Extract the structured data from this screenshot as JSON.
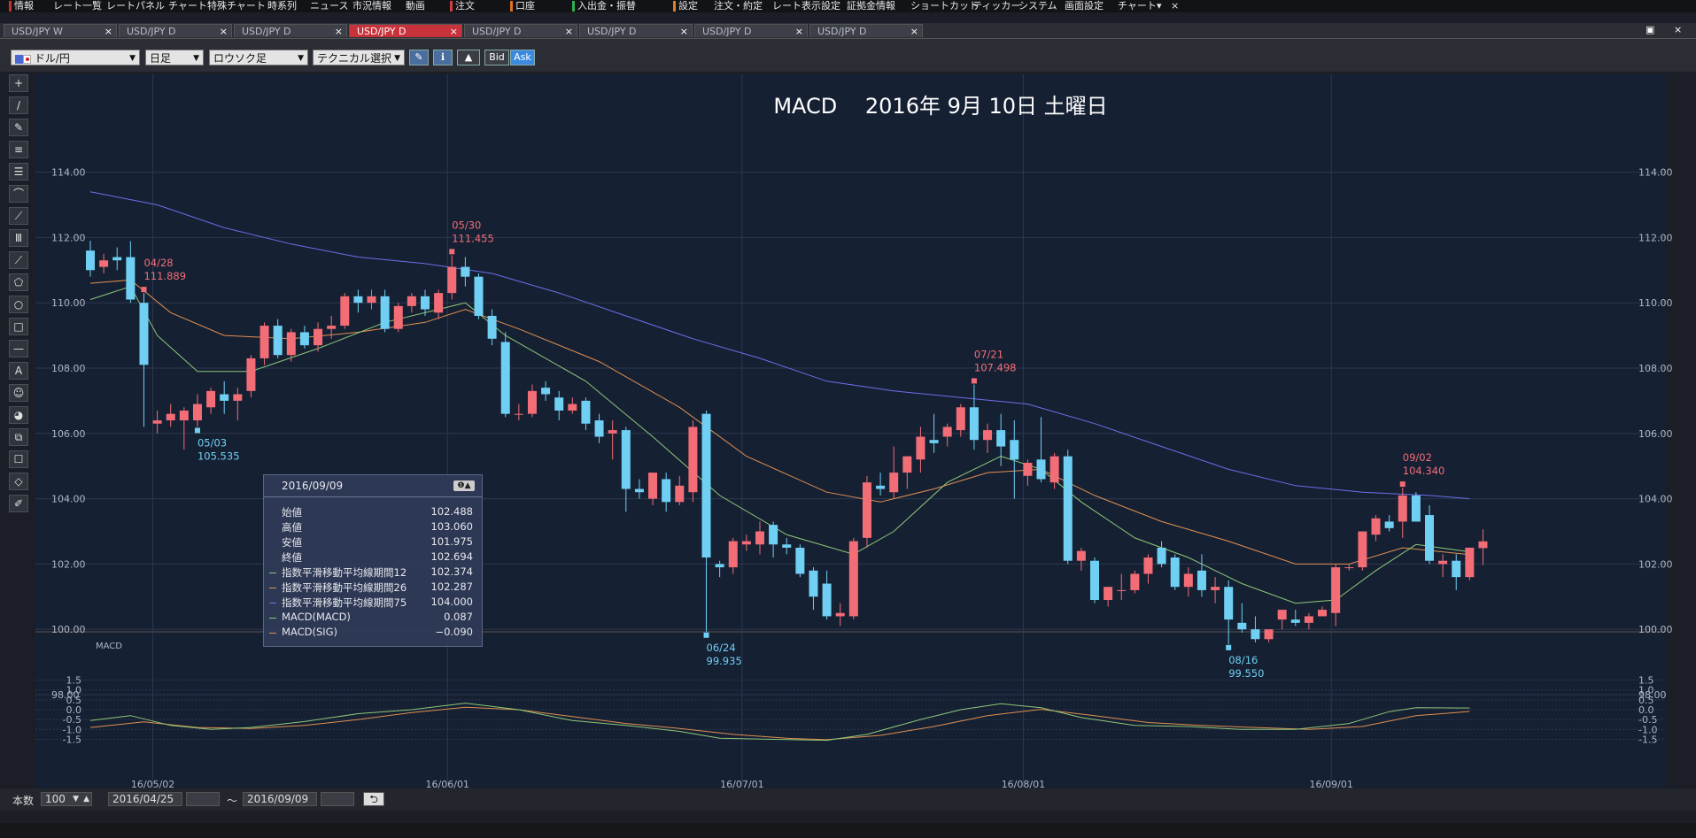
{
  "menu": {
    "items": [
      {
        "label": "情報",
        "x": 16,
        "mark": "#c83030"
      },
      {
        "label": "レート一覧",
        "x": 60
      },
      {
        "label": "レートパネル",
        "x": 120
      },
      {
        "label": "チャート",
        "x": 190
      },
      {
        "label": "特殊チャート",
        "x": 234
      },
      {
        "label": "時系列",
        "x": 302
      },
      {
        "label": "ニュース",
        "x": 350
      },
      {
        "label": "市況情報",
        "x": 398
      },
      {
        "label": "動画",
        "x": 458
      },
      {
        "label": "注文",
        "x": 514,
        "mark": "#d04040"
      },
      {
        "label": "口座",
        "x": 582,
        "mark": "#e07020"
      },
      {
        "label": "入出金・振替",
        "x": 652,
        "mark": "#30b050"
      },
      {
        "label": "設定",
        "x": 766,
        "mark": "#e08020"
      },
      {
        "label": "注文・約定",
        "x": 806
      },
      {
        "label": "レート表示設定",
        "x": 872
      },
      {
        "label": "証拠金情報",
        "x": 956
      },
      {
        "label": "ショートカット",
        "x": 1028
      },
      {
        "label": "ティッカー",
        "x": 1098
      },
      {
        "label": "システム",
        "x": 1150
      },
      {
        "label": "画面設定",
        "x": 1202
      },
      {
        "label": "チャート",
        "x": 1262
      },
      {
        "label": "▾",
        "x": 1306
      },
      {
        "label": "×",
        "x": 1322
      }
    ]
  },
  "tabs": [
    {
      "label": "USD/JPY W",
      "active": false
    },
    {
      "label": "USD/JPY D",
      "active": false
    },
    {
      "label": "USD/JPY D",
      "active": false
    },
    {
      "label": "USD/JPY D",
      "active": true
    },
    {
      "label": "USD/JPY D",
      "active": false
    },
    {
      "label": "USD/JPY D",
      "active": false
    },
    {
      "label": "USD/JPY D",
      "active": false
    },
    {
      "label": "USD/JPY D",
      "active": false
    }
  ],
  "window_controls": [
    "▣",
    "×"
  ],
  "toolbar": {
    "pair": "ドル/円",
    "period": "日足",
    "chart_type": "ロウソク足",
    "technical": "テクニカル選択",
    "bid": "Bid",
    "ask": "Ask"
  },
  "left_tools": [
    "+",
    "/",
    "✎",
    "≡",
    "☰",
    "⌒",
    "⟋",
    "Ⅲ",
    "⟋",
    "⬠",
    "○",
    "□",
    "—",
    "A",
    "☺",
    "◕",
    "⧉",
    "☐",
    "◇",
    "✐"
  ],
  "info_panel": {
    "date": "2016/09/09",
    "rows": [
      {
        "label": "始値",
        "value": "102.488"
      },
      {
        "label": "高値",
        "value": "103.060"
      },
      {
        "label": "安値",
        "value": "101.975"
      },
      {
        "label": "終値",
        "value": "102.694"
      },
      {
        "label": "指数平滑移動平均線期間12",
        "value": "102.374",
        "color": "#8ec878"
      },
      {
        "label": "指数平滑移動平均線期間26",
        "value": "102.287",
        "color": "#e09050"
      },
      {
        "label": "指数平滑移動平均線期間75",
        "value": "104.000",
        "color": "#6e72e6"
      },
      {
        "label": "MACD(MACD)",
        "value": "0.087",
        "color": "#8ec878"
      },
      {
        "label": "MACD(SIG)",
        "value": "−0.090",
        "color": "#e09050"
      }
    ]
  },
  "status": {
    "count_label": "本数",
    "count_value": "100",
    "from_date": "2016/04/25",
    "tilde": "〜",
    "to_date": "2016/09/09",
    "reset_icon": "⮌"
  },
  "chart_data": {
    "type": "candlestick",
    "title": "MACD　 2016年 9月 10日 土曜日",
    "y_axis": {
      "min": 98,
      "max": 114,
      "ticks": [
        "114.00",
        "112.00",
        "110.00",
        "108.00",
        "106.00",
        "104.00",
        "102.00",
        "100.00",
        "98.00"
      ]
    },
    "x_ticks": [
      {
        "label": "16/05/02",
        "index": 5
      },
      {
        "label": "16/06/01",
        "index": 27
      },
      {
        "label": "16/07/01",
        "index": 49
      },
      {
        "label": "16/08/01",
        "index": 70
      },
      {
        "label": "16/09/01",
        "index": 93
      }
    ],
    "candles": [
      [
        111.6,
        111.9,
        110.8,
        111.0
      ],
      [
        111.1,
        111.5,
        110.9,
        111.3
      ],
      [
        111.4,
        111.7,
        111.0,
        111.3
      ],
      [
        111.4,
        111.89,
        110.0,
        110.1
      ],
      [
        110.0,
        110.3,
        106.2,
        108.1
      ],
      [
        106.3,
        106.7,
        106.0,
        106.4
      ],
      [
        106.4,
        106.9,
        106.2,
        106.6
      ],
      [
        106.4,
        106.8,
        105.5,
        106.7
      ],
      [
        106.4,
        107.2,
        106.2,
        106.9
      ],
      [
        106.8,
        107.4,
        106.6,
        107.3
      ],
      [
        107.2,
        107.6,
        106.6,
        107.0
      ],
      [
        107.0,
        107.4,
        106.4,
        107.2
      ],
      [
        107.3,
        108.4,
        107.1,
        108.3
      ],
      [
        108.3,
        109.4,
        108.1,
        109.3
      ],
      [
        109.3,
        109.5,
        108.3,
        108.4
      ],
      [
        108.4,
        109.2,
        108.2,
        109.1
      ],
      [
        109.1,
        109.3,
        108.6,
        108.7
      ],
      [
        108.7,
        109.4,
        108.5,
        109.2
      ],
      [
        109.2,
        109.6,
        108.9,
        109.3
      ],
      [
        109.3,
        110.3,
        109.2,
        110.2
      ],
      [
        110.2,
        110.4,
        109.7,
        110.0
      ],
      [
        110.0,
        110.4,
        109.8,
        110.2
      ],
      [
        110.2,
        110.4,
        109.1,
        109.2
      ],
      [
        109.2,
        110.0,
        109.1,
        109.9
      ],
      [
        109.9,
        110.3,
        109.7,
        110.2
      ],
      [
        110.2,
        110.4,
        109.6,
        109.8
      ],
      [
        109.7,
        110.4,
        109.5,
        110.3
      ],
      [
        110.3,
        111.46,
        110.1,
        111.1
      ],
      [
        111.1,
        111.4,
        110.5,
        110.8
      ],
      [
        110.8,
        110.9,
        109.5,
        109.6
      ],
      [
        109.6,
        109.8,
        108.7,
        108.9
      ],
      [
        108.8,
        109.1,
        106.5,
        106.6
      ],
      [
        106.6,
        106.9,
        106.4,
        106.6
      ],
      [
        106.6,
        107.5,
        106.5,
        107.3
      ],
      [
        107.4,
        107.6,
        107.0,
        107.2
      ],
      [
        107.1,
        107.3,
        106.4,
        106.7
      ],
      [
        106.7,
        107.1,
        106.6,
        106.9
      ],
      [
        107.0,
        107.1,
        106.1,
        106.3
      ],
      [
        106.4,
        106.6,
        105.7,
        105.9
      ],
      [
        106.0,
        106.4,
        105.2,
        106.1
      ],
      [
        106.1,
        106.2,
        103.6,
        104.3
      ],
      [
        104.3,
        104.6,
        104.0,
        104.2
      ],
      [
        104.0,
        104.8,
        103.8,
        104.8
      ],
      [
        104.6,
        104.8,
        103.6,
        103.9
      ],
      [
        103.9,
        104.7,
        103.8,
        104.4
      ],
      [
        104.2,
        106.4,
        103.9,
        106.2
      ],
      [
        106.6,
        106.7,
        99.93,
        102.2
      ],
      [
        102.0,
        102.1,
        101.6,
        101.9
      ],
      [
        101.9,
        102.8,
        101.7,
        102.7
      ],
      [
        102.6,
        102.9,
        102.4,
        102.7
      ],
      [
        102.6,
        103.3,
        102.3,
        103.0
      ],
      [
        103.2,
        103.3,
        102.2,
        102.6
      ],
      [
        102.6,
        102.8,
        102.3,
        102.5
      ],
      [
        102.5,
        102.6,
        101.6,
        101.7
      ],
      [
        101.8,
        101.9,
        100.6,
        101.0
      ],
      [
        101.4,
        101.8,
        100.3,
        100.4
      ],
      [
        100.4,
        100.8,
        100.1,
        100.5
      ],
      [
        100.4,
        102.8,
        100.3,
        102.7
      ],
      [
        102.8,
        104.7,
        102.5,
        104.5
      ],
      [
        104.4,
        104.8,
        104.1,
        104.3
      ],
      [
        104.2,
        105.6,
        104.0,
        104.8
      ],
      [
        104.8,
        105.3,
        104.3,
        105.3
      ],
      [
        105.2,
        106.2,
        104.8,
        105.9
      ],
      [
        105.8,
        106.6,
        105.4,
        105.7
      ],
      [
        105.9,
        106.3,
        105.6,
        106.2
      ],
      [
        106.1,
        106.9,
        105.9,
        106.8
      ],
      [
        106.8,
        107.5,
        105.5,
        105.8
      ],
      [
        105.8,
        106.3,
        105.4,
        106.1
      ],
      [
        106.1,
        106.6,
        105.0,
        105.6
      ],
      [
        105.8,
        106.4,
        104.0,
        105.2
      ],
      [
        104.7,
        105.2,
        104.4,
        105.1
      ],
      [
        105.2,
        106.5,
        104.5,
        104.6
      ],
      [
        104.5,
        105.4,
        104.3,
        105.3
      ],
      [
        105.3,
        105.5,
        102.0,
        102.1
      ],
      [
        102.1,
        102.5,
        101.8,
        102.4
      ],
      [
        102.1,
        102.2,
        100.8,
        100.9
      ],
      [
        100.9,
        101.3,
        100.7,
        101.3
      ],
      [
        101.2,
        101.7,
        100.9,
        101.2
      ],
      [
        101.2,
        101.8,
        101.1,
        101.7
      ],
      [
        101.7,
        102.3,
        101.4,
        102.2
      ],
      [
        102.5,
        102.7,
        101.9,
        102.0
      ],
      [
        102.2,
        102.3,
        101.2,
        101.3
      ],
      [
        101.3,
        101.9,
        101.0,
        101.7
      ],
      [
        101.8,
        102.3,
        101.0,
        101.2
      ],
      [
        101.2,
        101.6,
        100.8,
        101.3
      ],
      [
        101.3,
        101.5,
        99.55,
        100.3
      ],
      [
        100.2,
        100.8,
        99.9,
        100.0
      ],
      [
        100.0,
        100.4,
        99.6,
        99.7
      ],
      [
        99.7,
        100.0,
        99.6,
        100.0
      ],
      [
        100.3,
        100.6,
        100.0,
        100.6
      ],
      [
        100.3,
        100.6,
        100.1,
        100.2
      ],
      [
        100.2,
        100.5,
        100.0,
        100.4
      ],
      [
        100.4,
        100.7,
        100.4,
        100.6
      ],
      [
        100.5,
        102.0,
        100.1,
        101.9
      ],
      [
        101.9,
        102.0,
        101.8,
        101.9
      ],
      [
        101.9,
        103.0,
        101.8,
        103.0
      ],
      [
        102.9,
        103.5,
        102.7,
        103.4
      ],
      [
        103.3,
        103.5,
        103.0,
        103.1
      ],
      [
        103.3,
        104.34,
        102.8,
        104.1
      ],
      [
        104.1,
        104.2,
        103.3,
        103.3
      ],
      [
        103.5,
        103.8,
        102.0,
        102.1
      ],
      [
        102.0,
        102.3,
        101.6,
        102.1
      ],
      [
        102.1,
        102.3,
        101.2,
        101.6
      ],
      [
        101.6,
        102.5,
        101.5,
        102.5
      ],
      [
        102.488,
        103.06,
        101.975,
        102.694
      ]
    ],
    "annotations": [
      {
        "index": 4,
        "date": "04/28",
        "value": "111.889",
        "pos": "high"
      },
      {
        "index": 8,
        "date": "05/03",
        "value": "105.535",
        "pos": "low"
      },
      {
        "index": 27,
        "date": "05/30",
        "value": "111.455",
        "pos": "high"
      },
      {
        "index": 46,
        "date": "06/24",
        "value": "99.935",
        "pos": "low"
      },
      {
        "index": 66,
        "date": "07/21",
        "value": "107.498",
        "pos": "high"
      },
      {
        "index": 85,
        "date": "08/16",
        "value": "99.550",
        "pos": "low"
      },
      {
        "index": 98,
        "date": "09/02",
        "value": "104.340",
        "pos": "high"
      }
    ],
    "ema12": [
      [
        0,
        110.1
      ],
      [
        3,
        110.5
      ],
      [
        5,
        109.0
      ],
      [
        8,
        107.9
      ],
      [
        12,
        107.9
      ],
      [
        17,
        108.6
      ],
      [
        22,
        109.4
      ],
      [
        26,
        109.8
      ],
      [
        28,
        110.0
      ],
      [
        31,
        109.0
      ],
      [
        37,
        107.6
      ],
      [
        42,
        105.9
      ],
      [
        47,
        104.1
      ],
      [
        52,
        102.9
      ],
      [
        57,
        102.3
      ],
      [
        60,
        103.0
      ],
      [
        64,
        104.5
      ],
      [
        68,
        105.3
      ],
      [
        71,
        104.9
      ],
      [
        74,
        103.9
      ],
      [
        78,
        102.8
      ],
      [
        82,
        102.2
      ],
      [
        86,
        101.4
      ],
      [
        90,
        100.8
      ],
      [
        93,
        100.9
      ],
      [
        96,
        101.8
      ],
      [
        99,
        102.6
      ],
      [
        103,
        102.374
      ]
    ],
    "ema26": [
      [
        0,
        110.6
      ],
      [
        3,
        110.7
      ],
      [
        6,
        109.7
      ],
      [
        10,
        109.0
      ],
      [
        15,
        108.9
      ],
      [
        20,
        109.1
      ],
      [
        25,
        109.4
      ],
      [
        28,
        109.8
      ],
      [
        32,
        109.2
      ],
      [
        38,
        108.2
      ],
      [
        44,
        106.8
      ],
      [
        49,
        105.3
      ],
      [
        55,
        104.2
      ],
      [
        59,
        103.9
      ],
      [
        63,
        104.3
      ],
      [
        67,
        104.8
      ],
      [
        71,
        104.9
      ],
      [
        75,
        104.1
      ],
      [
        80,
        103.3
      ],
      [
        85,
        102.7
      ],
      [
        90,
        102.0
      ],
      [
        94,
        102.0
      ],
      [
        98,
        102.5
      ],
      [
        103,
        102.287
      ]
    ],
    "ema75": [
      [
        0,
        113.4
      ],
      [
        5,
        113.0
      ],
      [
        10,
        112.3
      ],
      [
        15,
        111.8
      ],
      [
        20,
        111.4
      ],
      [
        25,
        111.2
      ],
      [
        30,
        110.9
      ],
      [
        35,
        110.3
      ],
      [
        40,
        109.6
      ],
      [
        45,
        108.9
      ],
      [
        50,
        108.3
      ],
      [
        55,
        107.6
      ],
      [
        60,
        107.3
      ],
      [
        65,
        107.1
      ],
      [
        70,
        106.9
      ],
      [
        75,
        106.3
      ],
      [
        80,
        105.6
      ],
      [
        85,
        104.9
      ],
      [
        90,
        104.4
      ],
      [
        95,
        104.2
      ],
      [
        100,
        104.1
      ],
      [
        103,
        104.0
      ]
    ],
    "macd_panel": {
      "label": "MACD",
      "ticks": [
        "1.5",
        "1.0",
        "0.5",
        "0.0",
        "-0.5",
        "-1.0",
        "-1.5"
      ],
      "ylim": [
        -1.5,
        1.5
      ]
    },
    "macd": [
      [
        0,
        -0.55
      ],
      [
        3,
        -0.3
      ],
      [
        6,
        -0.8
      ],
      [
        9,
        -1.0
      ],
      [
        12,
        -0.9
      ],
      [
        16,
        -0.6
      ],
      [
        20,
        -0.2
      ],
      [
        24,
        0.0
      ],
      [
        28,
        0.33
      ],
      [
        32,
        0.0
      ],
      [
        36,
        -0.55
      ],
      [
        40,
        -0.8
      ],
      [
        44,
        -1.1
      ],
      [
        47,
        -1.45
      ],
      [
        51,
        -1.5
      ],
      [
        55,
        -1.55
      ],
      [
        58,
        -1.25
      ],
      [
        62,
        -0.5
      ],
      [
        65,
        0.0
      ],
      [
        68,
        0.3
      ],
      [
        71,
        0.1
      ],
      [
        74,
        -0.4
      ],
      [
        78,
        -0.8
      ],
      [
        82,
        -0.85
      ],
      [
        86,
        -1.0
      ],
      [
        90,
        -1.0
      ],
      [
        94,
        -0.7
      ],
      [
        97,
        -0.1
      ],
      [
        99,
        0.1
      ],
      [
        103,
        0.087
      ]
    ],
    "signal": [
      [
        0,
        -0.9
      ],
      [
        4,
        -0.62
      ],
      [
        8,
        -0.9
      ],
      [
        12,
        -0.95
      ],
      [
        16,
        -0.8
      ],
      [
        20,
        -0.5
      ],
      [
        24,
        -0.15
      ],
      [
        28,
        0.12
      ],
      [
        32,
        0.0
      ],
      [
        36,
        -0.35
      ],
      [
        40,
        -0.7
      ],
      [
        44,
        -0.95
      ],
      [
        48,
        -1.25
      ],
      [
        52,
        -1.45
      ],
      [
        55,
        -1.52
      ],
      [
        59,
        -1.3
      ],
      [
        63,
        -0.85
      ],
      [
        67,
        -0.3
      ],
      [
        71,
        0.02
      ],
      [
        75,
        -0.3
      ],
      [
        79,
        -0.65
      ],
      [
        83,
        -0.8
      ],
      [
        87,
        -0.9
      ],
      [
        91,
        -1.0
      ],
      [
        95,
        -0.85
      ],
      [
        99,
        -0.3
      ],
      [
        103,
        -0.09
      ]
    ]
  }
}
